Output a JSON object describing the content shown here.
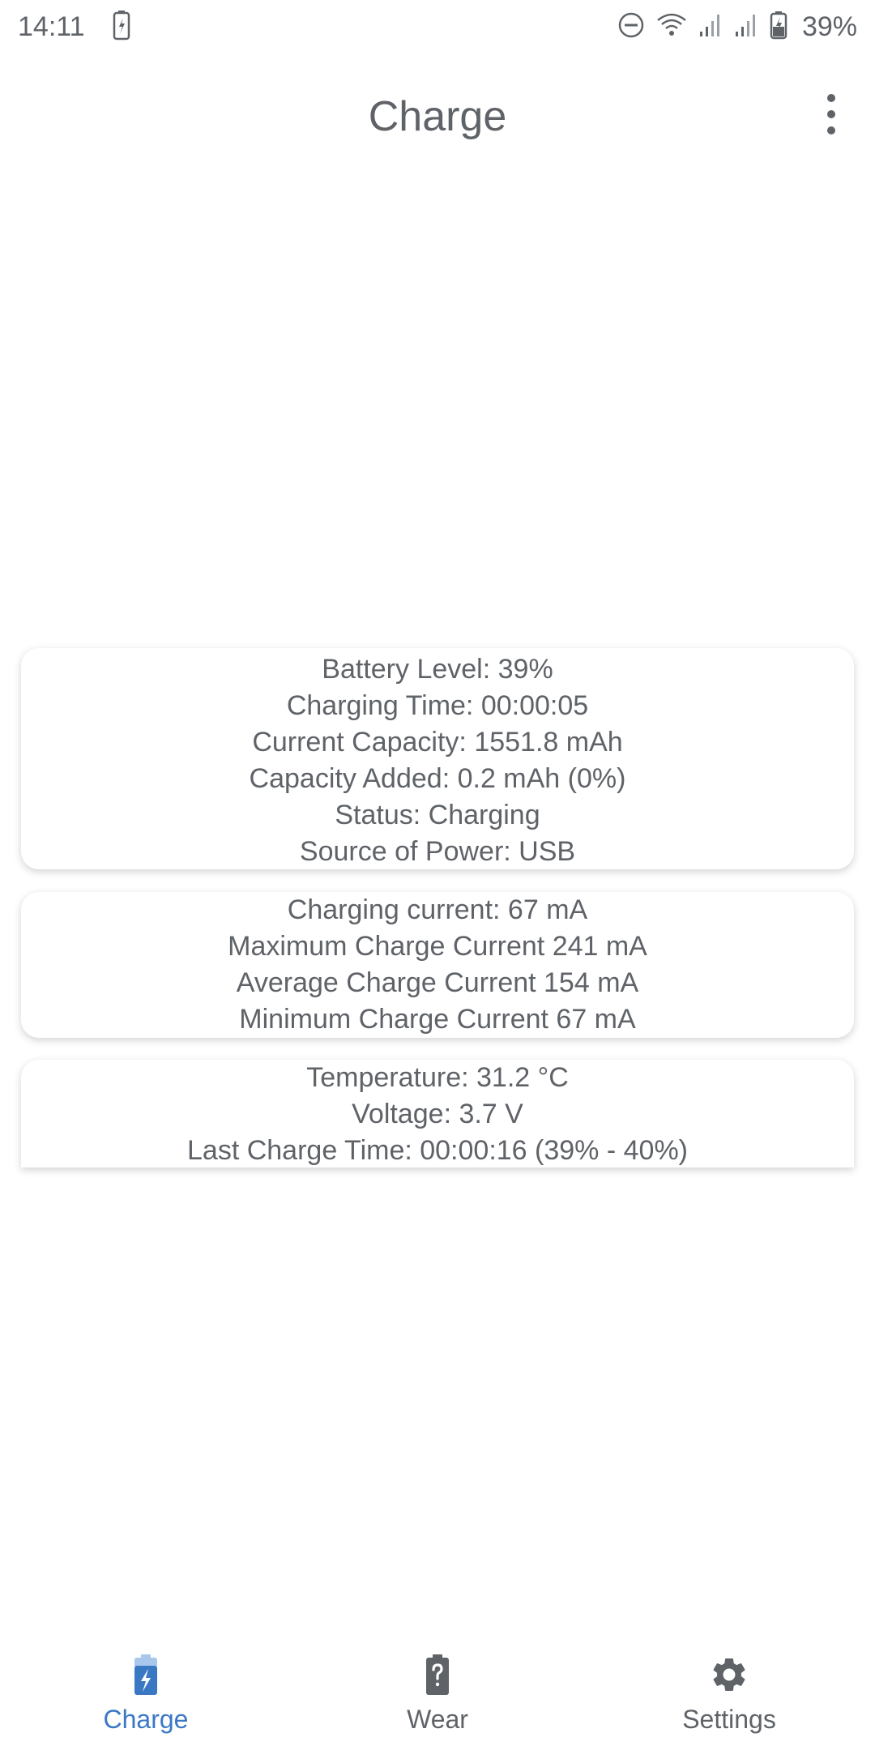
{
  "status_bar": {
    "time": "14:11",
    "battery": "39%"
  },
  "app_bar": {
    "title": "Charge"
  },
  "cards": {
    "battery": [
      "Battery Level: 39%",
      "Charging Time: 00:00:05",
      "Current Capacity: 1551.8 mAh",
      "Capacity Added: 0.2 mAh (0%)",
      "Status: Charging",
      "Source of Power: USB"
    ],
    "current": [
      "Charging current: 67 mA",
      "Maximum Charge Current 241 mA",
      "Average Charge Current 154 mA",
      "Minimum Charge Current 67 mA"
    ],
    "misc": [
      "Temperature: 31.2 °C",
      "Voltage: 3.7 V",
      "Last Charge Time: 00:00:16 (39% - 40%)"
    ]
  },
  "bottom_nav": {
    "items": [
      {
        "label": "Charge",
        "icon": "charging-battery-icon",
        "active": true
      },
      {
        "label": "Wear",
        "icon": "watch-question-icon",
        "active": false
      },
      {
        "label": "Settings",
        "icon": "gear-icon",
        "active": false
      }
    ]
  },
  "colors": {
    "accent": "#3b78c4",
    "text": "#5f6368",
    "background": "#ffffff"
  }
}
